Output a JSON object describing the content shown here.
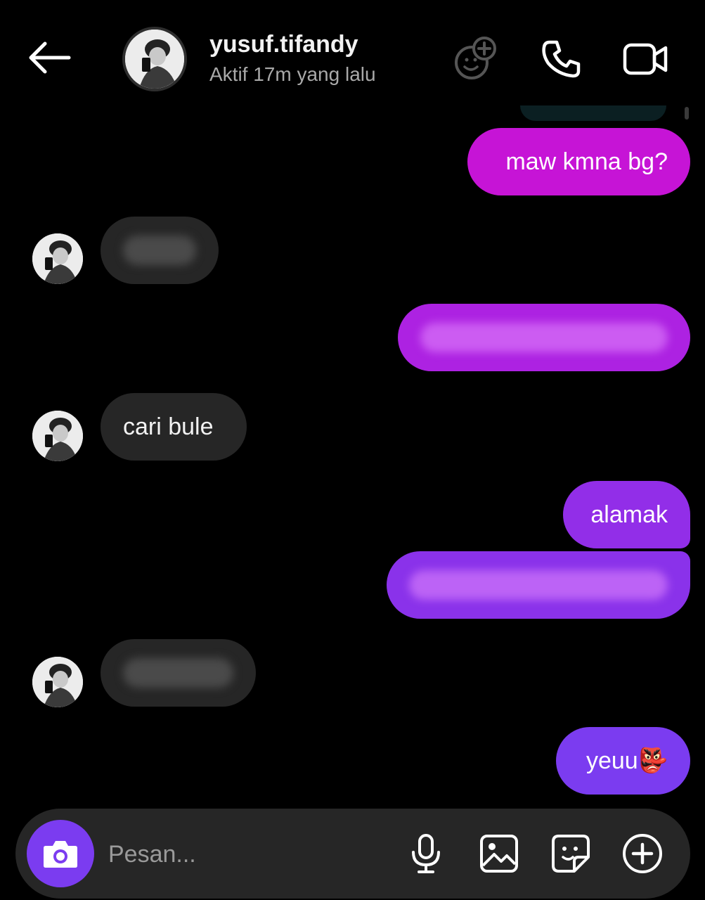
{
  "header": {
    "username": "yusuf.tifandy",
    "status": "Aktif 17m yang lalu"
  },
  "icons": {
    "back": "back-arrow-icon",
    "effects": "face-effects-icon",
    "call": "phone-icon",
    "video": "video-camera-icon",
    "camera": "camera-icon",
    "mic": "microphone-icon",
    "gallery": "gallery-icon",
    "sticker": "sticker-icon",
    "plus": "plus-circle-icon"
  },
  "colors": {
    "background": "#000000",
    "incoming_bubble": "#262626",
    "outgoing_gradient_top": "#c614d6",
    "outgoing_gradient_bottom": "#7b3cf0",
    "camera_button": "#7b3cf0"
  },
  "messages": [
    {
      "side": "out",
      "text": "maw kmna bg?"
    },
    {
      "side": "in",
      "text": ""
    },
    {
      "side": "out",
      "text": ""
    },
    {
      "side": "in",
      "text": "cari bule"
    },
    {
      "side": "out",
      "text": "alamak"
    },
    {
      "side": "out",
      "text": ""
    },
    {
      "side": "in",
      "text": ""
    },
    {
      "side": "out",
      "text": "yeuu👺"
    }
  ],
  "composer": {
    "placeholder": "Pesan..."
  }
}
